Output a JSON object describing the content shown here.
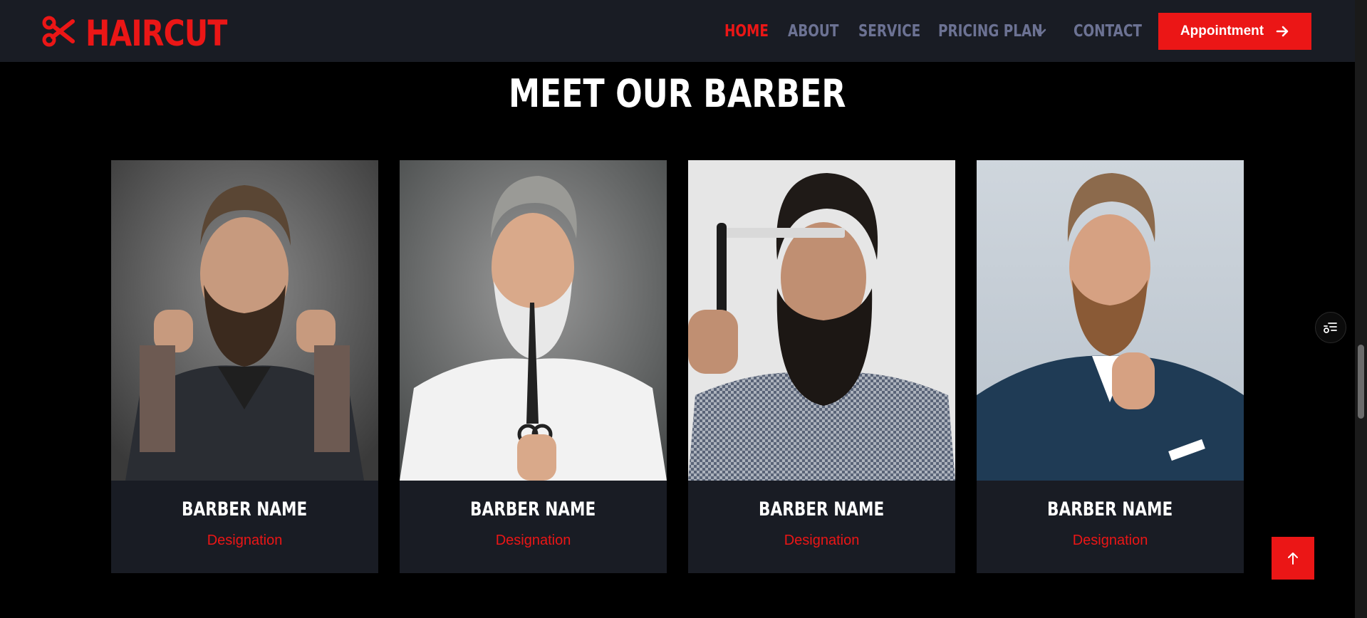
{
  "brand": {
    "name": "HAIRCUT",
    "icon": "scissors-icon",
    "color": "#eb1616"
  },
  "nav": {
    "items": [
      {
        "label": "HOME",
        "active": true
      },
      {
        "label": "ABOUT",
        "active": false
      },
      {
        "label": "SERVICE",
        "active": false
      },
      {
        "label": "PRICING PLAN",
        "active": false,
        "dropdown": true
      },
      {
        "label": "CONTACT",
        "active": false
      }
    ],
    "cta_label": "Appointment",
    "cta_icon": "arrow-right-icon"
  },
  "section": {
    "title": "MEET OUR BARBER"
  },
  "barbers": [
    {
      "name": "BARBER NAME",
      "designation": "Designation"
    },
    {
      "name": "BARBER NAME",
      "designation": "Designation"
    },
    {
      "name": "BARBER NAME",
      "designation": "Designation"
    },
    {
      "name": "BARBER NAME",
      "designation": "Designation"
    }
  ],
  "widgets": {
    "floating_icon": "settings-list-icon",
    "back_to_top_icon": "arrow-up-icon"
  },
  "colors": {
    "accent": "#eb1616",
    "nav_bg": "#191c24",
    "page_bg": "#000000",
    "muted": "#6c7293"
  }
}
